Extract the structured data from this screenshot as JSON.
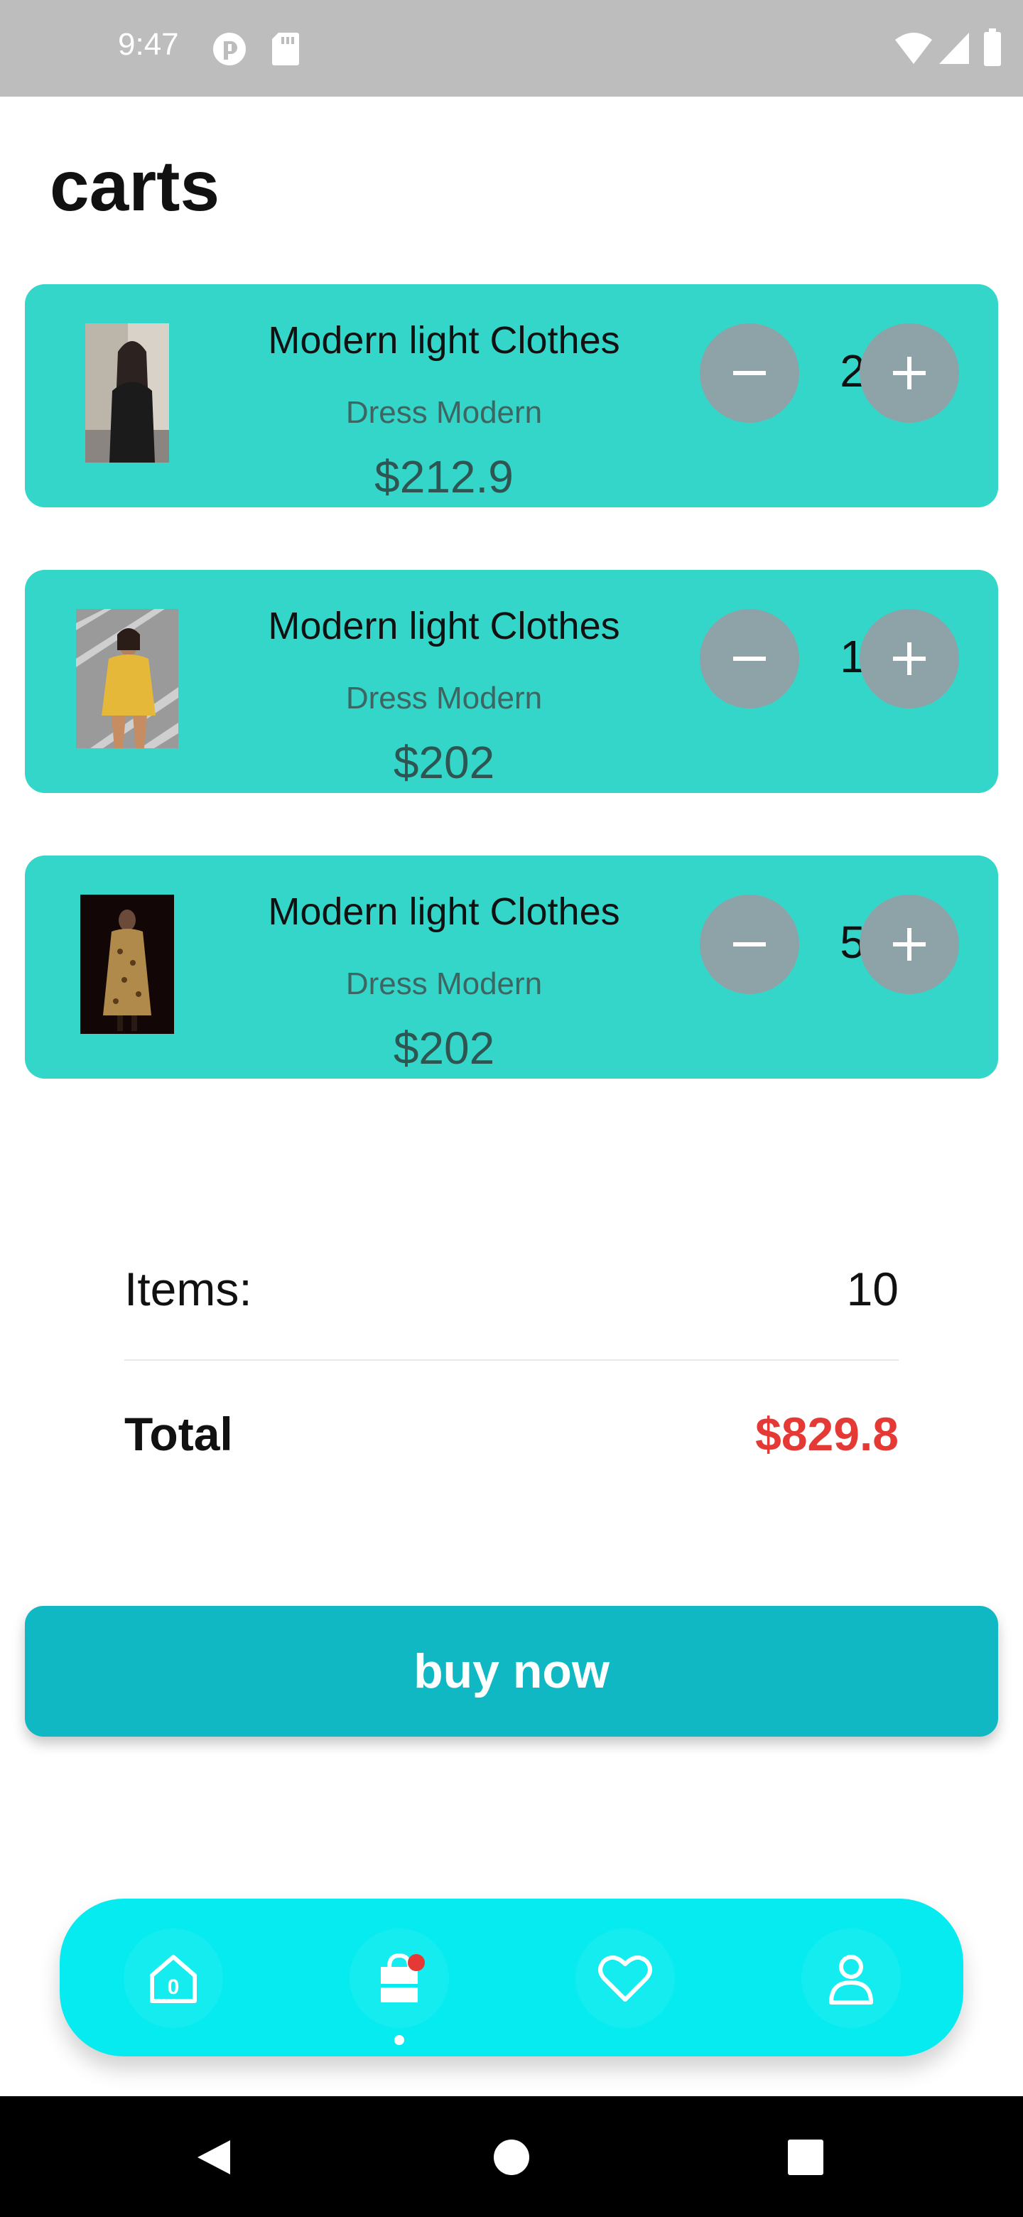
{
  "status_bar": {
    "time": "9:47"
  },
  "page": {
    "title": "carts"
  },
  "cart_items": [
    {
      "name": "Modern light Clothes",
      "category": "Dress Modern",
      "price": "$212.9",
      "quantity": "2"
    },
    {
      "name": "Modern light Clothes",
      "category": "Dress Modern",
      "price": "$202",
      "quantity": "1"
    },
    {
      "name": "Modern light Clothes",
      "category": "Dress Modern",
      "price": "$202",
      "quantity": "5"
    }
  ],
  "summary": {
    "items_label": "Items:",
    "items_value": "10",
    "total_label": "Total",
    "total_value": "$829.8"
  },
  "buy_button": {
    "label": "buy now"
  },
  "bottom_nav": {
    "home_badge": "0",
    "items": [
      "home-icon",
      "cart-icon",
      "heart-icon",
      "profile-icon"
    ],
    "active": "cart-icon"
  },
  "colors": {
    "card": "#33d6c8",
    "buy_button": "#0fb8c2",
    "bottom_nav": "#06ebf0",
    "total": "#e53935",
    "qty_button": "#8ea3a8"
  }
}
